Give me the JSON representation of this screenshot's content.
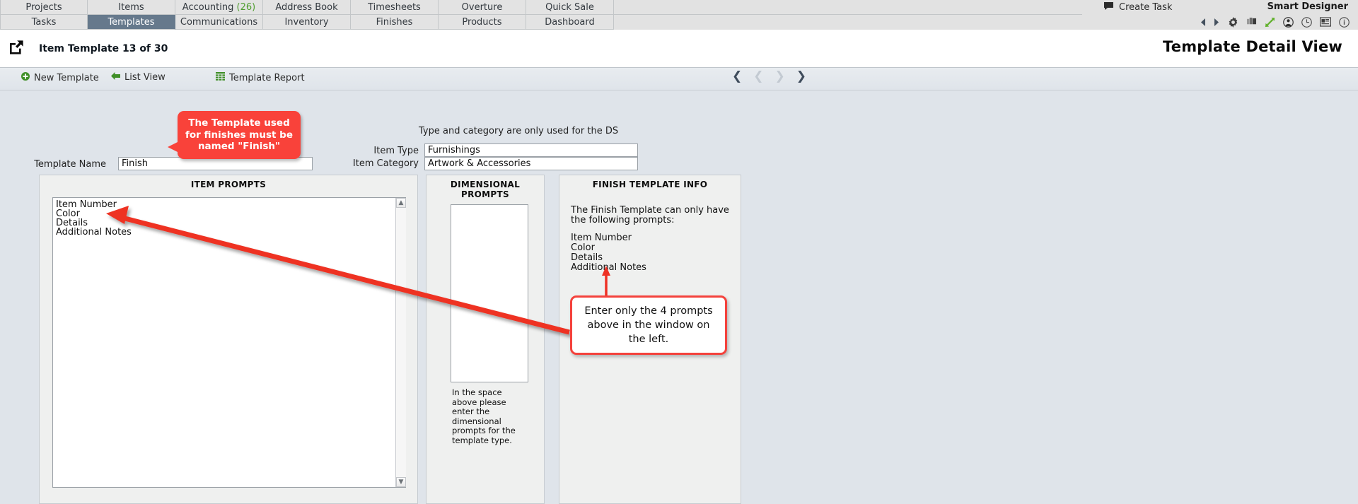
{
  "nav": {
    "row1": [
      {
        "label": "Projects",
        "active": false
      },
      {
        "label": "Items",
        "active": false
      },
      {
        "label": "Accounting",
        "badge": "(26)",
        "active": false
      },
      {
        "label": "Address Book",
        "active": false
      },
      {
        "label": "Timesheets",
        "active": false
      },
      {
        "label": "Overture",
        "active": false
      },
      {
        "label": "Quick Sale",
        "active": false
      }
    ],
    "row2": [
      {
        "label": "Tasks",
        "active": false
      },
      {
        "label": "Templates",
        "active": true
      },
      {
        "label": "Communications",
        "active": false
      },
      {
        "label": "Inventory",
        "active": false
      },
      {
        "label": "Finishes",
        "active": false
      },
      {
        "label": "Products",
        "active": false
      },
      {
        "label": "Dashboard",
        "active": false
      }
    ]
  },
  "tools": {
    "create_task": "Create Task",
    "brand": "Smart Designer",
    "icons": [
      "back-arrow-icon",
      "forward-arrow-icon",
      "gear-icon",
      "copy-icon",
      "expand-icon",
      "user-icon",
      "clock-icon",
      "news-icon",
      "info-icon"
    ]
  },
  "header": {
    "external_link_icon": "external-link-icon",
    "subtitle": "Item Template 13 of 30",
    "title": "Template Detail View"
  },
  "toolbar": {
    "new_template": "New Template",
    "list_view": "List View",
    "template_report": "Template Report",
    "pager": {
      "first": "❮",
      "prev": "❮",
      "next": "❯",
      "last": "❯"
    }
  },
  "form": {
    "ds_note": "Type and category are only used for the DS",
    "template_name_label": "Template Name",
    "template_name_value": "Finish",
    "item_type_label": "Item Type",
    "item_type_value": "Furnishings",
    "item_category_label": "Item Category",
    "item_category_value": "Artwork & Accessories"
  },
  "panels": {
    "item_prompts": {
      "title": "ITEM PROMPTS",
      "items": [
        "Item Number",
        "Color",
        "Details",
        "Additional Notes"
      ]
    },
    "dimensional_prompts": {
      "title": "DIMENSIONAL PROMPTS",
      "box_value": "",
      "note": "In the space above please enter the dimensional prompts for the template type."
    },
    "finish_template_info": {
      "title": "FINISH TEMPLATE INFO",
      "intro": "The Finish Template can only have the following prompts:",
      "prompts": [
        "Item Number",
        "Color",
        "Details",
        "Additional Notes"
      ]
    }
  },
  "callouts": {
    "name_rule": "The Template used for finishes must be named \"Finish\"",
    "prompts_rule": "Enter only the 4 prompts above in the window on the left."
  },
  "colors": {
    "accent_red": "#f9423a",
    "active_tab": "#66798c",
    "badge_green": "#4f9d2f",
    "page_bg": "#dfe4ea"
  }
}
